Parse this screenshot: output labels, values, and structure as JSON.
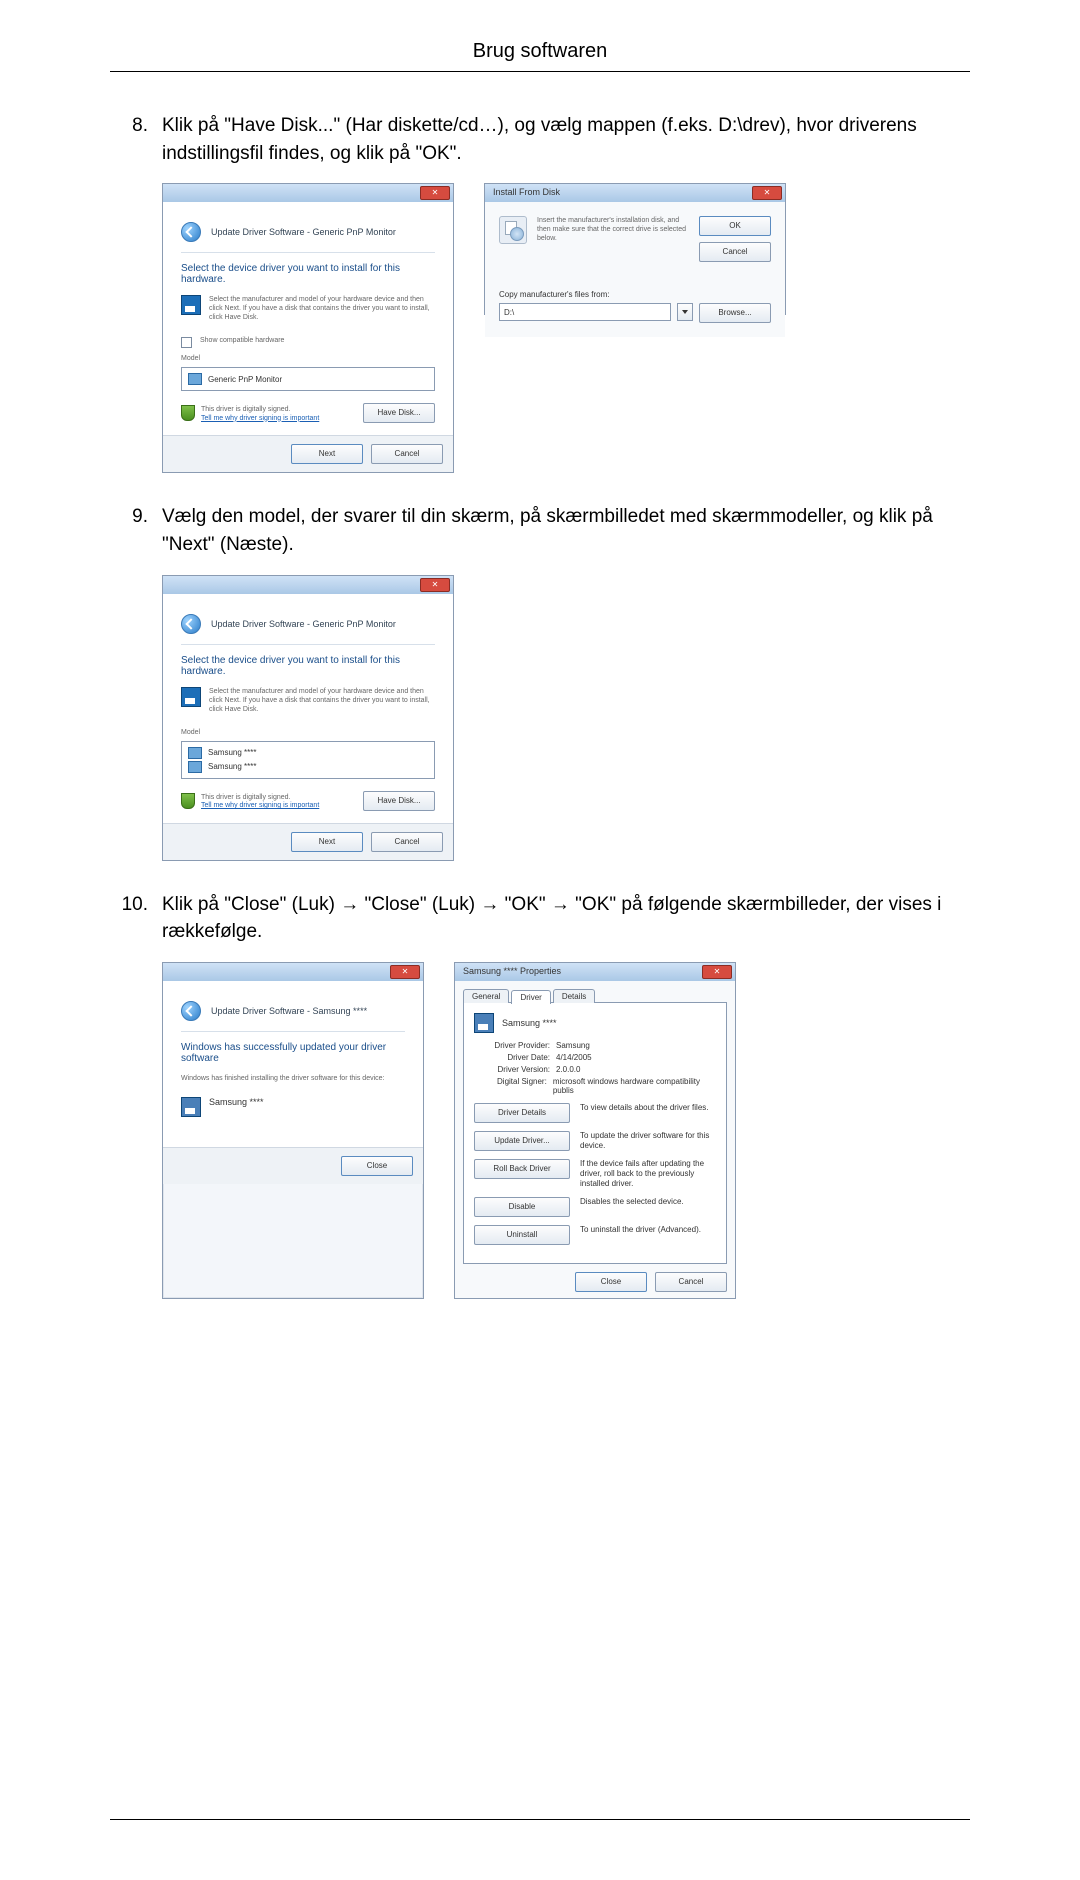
{
  "header": {
    "title": "Brug softwaren"
  },
  "steps": [
    {
      "num": "8.",
      "text": "Klik på \"Have Disk...\" (Har diskette/cd…), og vælg mappen (f.eks. D:\\drev), hvor driverens indstillingsfil findes, og klik på \"OK\"."
    },
    {
      "num": "9.",
      "text": "Vælg den model, der svarer til din skærm, på skærmbilledet med skærmmodeller, og klik på \"Next\" (Næste)."
    },
    {
      "num": "10.",
      "text": "Klik på \"Close\" (Luk) → \"Close\" (Luk) → \"OK\" → \"OK\" på følgende skærmbilleder, der vises i rækkefølge."
    }
  ],
  "dlg_select_driver": {
    "crumb": "Update Driver Software - Generic PnP Monitor",
    "heading": "Select the device driver you want to install for this hardware.",
    "hint": "Select the manufacturer and model of your hardware device and then click Next. If you have a disk that contains the driver you want to install, click Have Disk.",
    "show_compat": "Show compatible hardware",
    "model_label": "Model",
    "model_item": "Generic PnP Monitor",
    "signed": "This driver is digitally signed.",
    "tell_me": "Tell me why driver signing is important",
    "have_disk": "Have Disk...",
    "next": "Next",
    "cancel": "Cancel"
  },
  "dlg_install_disk": {
    "title": "Install From Disk",
    "msg": "Insert the manufacturer's installation disk, and then make sure that the correct drive is selected below.",
    "ok": "OK",
    "cancel": "Cancel",
    "copy_from": "Copy manufacturer's files from:",
    "path": "D:\\",
    "browse": "Browse..."
  },
  "dlg_select_model": {
    "crumb": "Update Driver Software - Generic PnP Monitor",
    "heading": "Select the device driver you want to install for this hardware.",
    "hint": "Select the manufacturer and model of your hardware device and then click Next. If you have a disk that contains the driver you want to install, click Have Disk.",
    "model_label": "Model",
    "item1": "Samsung ****",
    "item2": "Samsung ****",
    "signed": "This driver is digitally signed.",
    "tell_me": "Tell me why driver signing is important",
    "have_disk": "Have Disk...",
    "next": "Next",
    "cancel": "Cancel"
  },
  "dlg_success": {
    "crumb": "Update Driver Software - Samsung ****",
    "heading": "Windows has successfully updated your driver software",
    "sub": "Windows has finished installing the driver software for this device:",
    "device": "Samsung ****",
    "close": "Close"
  },
  "dlg_props": {
    "title": "Samsung **** Properties",
    "tabs": {
      "general": "General",
      "driver": "Driver",
      "details": "Details"
    },
    "device": "Samsung ****",
    "rows": {
      "provider_l": "Driver Provider:",
      "provider_v": "Samsung",
      "date_l": "Driver Date:",
      "date_v": "4/14/2005",
      "version_l": "Driver Version:",
      "version_v": "2.0.0.0",
      "signer_l": "Digital Signer:",
      "signer_v": "microsoft windows hardware compatibility publis"
    },
    "btns": {
      "details": "Driver Details",
      "details_d": "To view details about the driver files.",
      "update": "Update Driver...",
      "update_d": "To update the driver software for this device.",
      "rollback": "Roll Back Driver",
      "rollback_d": "If the device fails after updating the driver, roll back to the previously installed driver.",
      "disable": "Disable",
      "disable_d": "Disables the selected device.",
      "uninstall": "Uninstall",
      "uninstall_d": "To uninstall the driver (Advanced)."
    },
    "close": "Close",
    "cancel": "Cancel"
  }
}
